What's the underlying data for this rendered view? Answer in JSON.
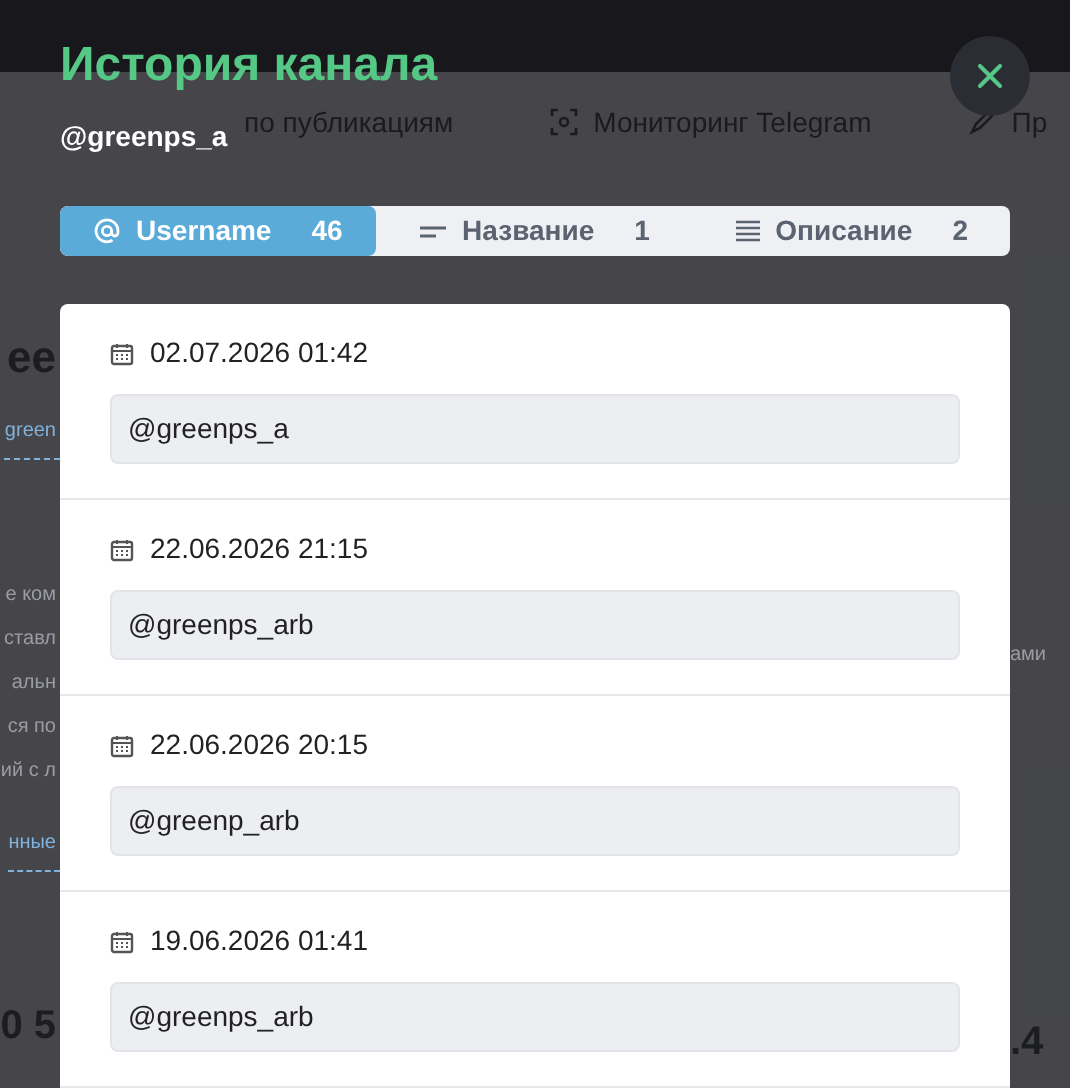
{
  "background": {
    "nav": [
      "по публикациям",
      "Мониторинг Telegram",
      "Пр"
    ],
    "left_texts": [
      {
        "kind": "heading",
        "text": "ee"
      },
      {
        "kind": "link",
        "text": "green"
      },
      {
        "kind": "text",
        "text": "е ком"
      },
      {
        "kind": "text",
        "text": "ставл"
      },
      {
        "kind": "text",
        "text": "альн"
      },
      {
        "kind": "text",
        "text": "ся по"
      },
      {
        "kind": "text",
        "text": "ий с л"
      },
      {
        "kind": "link",
        "text": "нные"
      },
      {
        "kind": "number",
        "text": "0 5"
      }
    ],
    "right_texts": [
      {
        "kind": "text",
        "text": "ами"
      },
      {
        "kind": "number",
        "text": ".4"
      }
    ]
  },
  "modal": {
    "title": "История канала",
    "subtitle": "@greenps_a",
    "tabs": [
      {
        "kind": "username",
        "label": "Username",
        "count": "46",
        "selected": true
      },
      {
        "kind": "name",
        "label": "Название",
        "count": "1",
        "selected": false
      },
      {
        "kind": "description",
        "label": "Описание",
        "count": "2",
        "selected": false
      }
    ],
    "entries": [
      {
        "date": "02.07.2026 01:42",
        "value": "@greenps_a"
      },
      {
        "date": "22.06.2026 21:15",
        "value": "@greenps_arb"
      },
      {
        "date": "22.06.2026 20:15",
        "value": "@greenp_arb"
      },
      {
        "date": "19.06.2026 01:41",
        "value": "@greenps_arb"
      }
    ]
  }
}
